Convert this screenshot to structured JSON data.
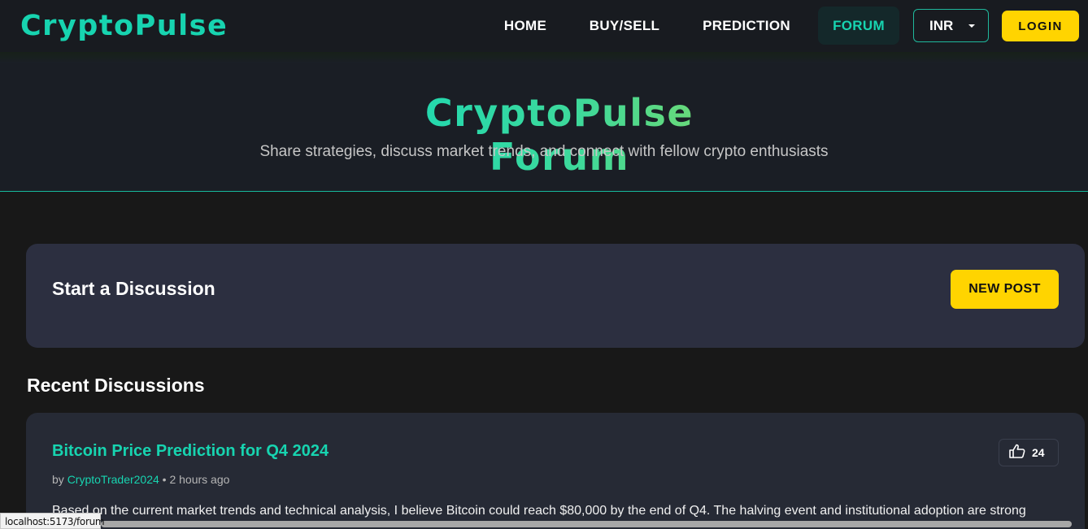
{
  "navbar": {
    "logo": "CryptoPulse",
    "links": [
      "HOME",
      "BUY/SELL",
      "PREDICTION",
      "FORUM"
    ],
    "active_link": "FORUM",
    "currency": "INR",
    "login_label": "LOGIN"
  },
  "hero": {
    "title": "CryptoPulse Forum",
    "subtitle": "Share strategies, discuss market trends, and connect with fellow crypto enthusiasts"
  },
  "start_discussion": {
    "title": "Start a Discussion",
    "button_label": "NEW POST"
  },
  "recent": {
    "title": "Recent Discussions",
    "posts": [
      {
        "title": "Bitcoin Price Prediction for Q4 2024",
        "by": "by",
        "author": "CryptoTrader2024",
        "time": "• 2 hours ago",
        "likes": "24",
        "body": "Based on the current market trends and technical analysis, I believe Bitcoin could reach $80,000 by the end of Q4. The halving event and institutional adoption are strong"
      }
    ]
  },
  "status_bar": {
    "url": "localhost:5173/forum"
  },
  "colors": {
    "accent": "#17d4b0",
    "button_yellow": "#ffd400",
    "background": "#181818",
    "card": "#2c2f40"
  }
}
